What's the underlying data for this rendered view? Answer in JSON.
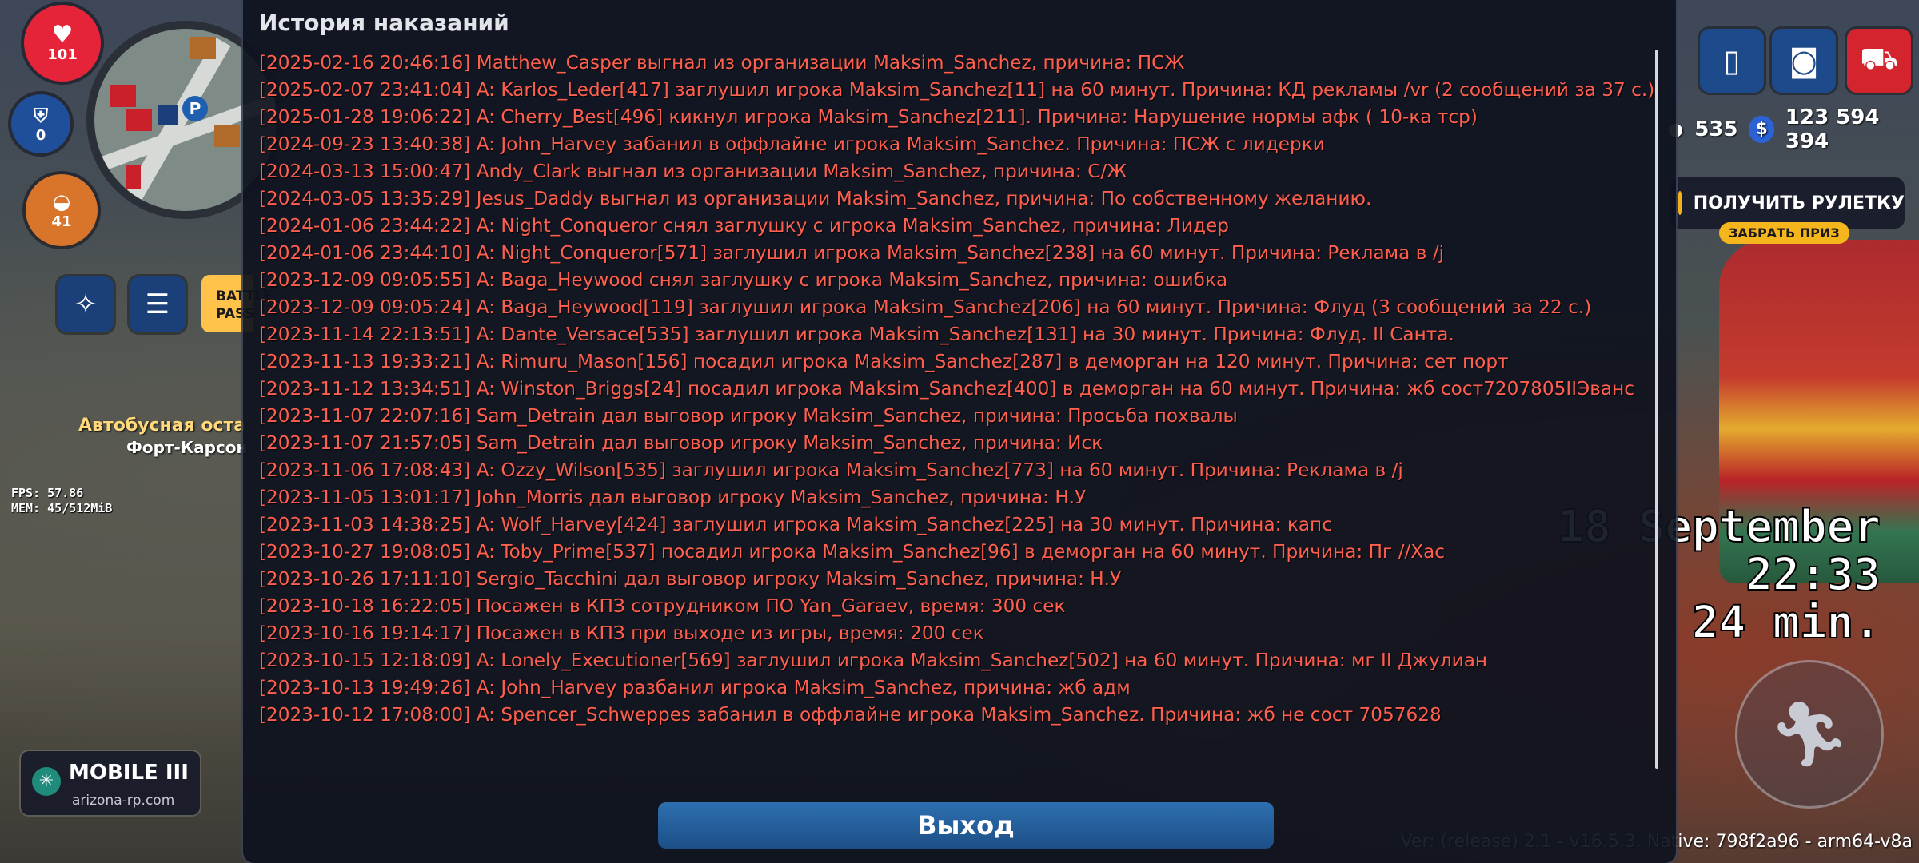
{
  "hud": {
    "health": "101",
    "armor": "0",
    "hunger": "41",
    "battle_pass": "BATTLE PASS",
    "bus_stop": "Автобусная оста",
    "location": "Форт-Карсон",
    "fps": "FPS:  57.86",
    "mem": "MEM: 45/512MiB",
    "logo_title": "MOBILE III",
    "logo_site": "arizona-rp.com",
    "donate_count": "535",
    "money": "123 594 394",
    "roulette": "ПОЛУЧИТЬ РУЛЕТКУ",
    "prize": "ЗАБРАТЬ ПРИЗ",
    "date_line": "18 September",
    "time_line": "22:33",
    "played_line": "24 min.",
    "version": "Ver: (release) 2.1 - v16.5.3. Native: 798f2a96 - arm64-v8a"
  },
  "panel": {
    "title": "История наказаний",
    "lines": [
      "[2025-02-16 20:46:16] Matthew_Casper выгнал из организации Maksim_Sanchez, причина: ПСЖ",
      "[2025-02-07 23:41:04]  A: Karlos_Leder[417] заглушил игрока Maksim_Sanchez[11] на 60 минут. Причина: КД рекламы /vr (2 сообщений за 37 с.)",
      "[2025-01-28 19:06:22]  A: Cherry_Best[496] кикнул игрока Maksim_Sanchez[211]. Причина: Нарушение нормы афк ( 10-ка тср)",
      "[2024-09-23 13:40:38]  A: John_Harvey забанил в оффлайне игрока Maksim_Sanchez. Причина: ПСЖ с лидерки",
      "[2024-03-13 15:00:47] Andy_Clark выгнал из организации Maksim_Sanchez, причина: С/Ж",
      "[2024-03-05 13:35:29] Jesus_Daddy выгнал из организации Maksim_Sanchez, причина: По собственному желанию.",
      "[2024-01-06 23:44:22]  A:  Night_Conqueror снял заглушку с игрока Maksim_Sanchez, причина: Лидер",
      "[2024-01-06 23:44:10]  A: Night_Conqueror[571] заглушил игрока Maksim_Sanchez[238] на 60 минут. Причина: Реклама в /j",
      "[2023-12-09 09:05:55]  A:  Baga_Heywood снял заглушку с игрока Maksim_Sanchez, причина: ошибка",
      "[2023-12-09 09:05:24]  A: Baga_Heywood[119] заглушил игрока Maksim_Sanchez[206] на 60 минут. Причина: Флуд (3 сообщений за 22 с.)",
      "[2023-11-14 22:13:51]  A: Dante_Versace[535] заглушил игрока Maksim_Sanchez[131] на 30 минут. Причина: Флуд. II Санта.",
      "[2023-11-13 19:33:21]  A: Rimuru_Mason[156] посадил игрока Maksim_Sanchez[287] в деморган на 120 минут. Причина: сет порт",
      "[2023-11-12 13:34:51]  A: Winston_Briggs[24] посадил игрока Maksim_Sanchez[400] в деморган на 60 минут. Причина: жб сост7207805IIЭванс",
      "[2023-11-07 22:07:16] Sam_Detrain дал выговор игроку Maksim_Sanchez, причина: Просьба похвалы",
      "[2023-11-07 21:57:05] Sam_Detrain дал выговор игроку Maksim_Sanchez, причина: Иск",
      "[2023-11-06 17:08:43]  A: Ozzy_Wilson[535] заглушил игрока Maksim_Sanchez[773] на 60 минут. Причина: Реклама в /j",
      "[2023-11-05 13:01:17] John_Morris дал выговор игроку Maksim_Sanchez, причина: Н.У",
      "[2023-11-03 14:38:25]  A: Wolf_Harvey[424] заглушил игрока Maksim_Sanchez[225] на 30 минут. Причина: капс",
      "[2023-10-27 19:08:05]  A: Toby_Prime[537] посадил игрока Maksim_Sanchez[96] в деморган на 60 минут. Причина: Пг //Хас",
      "[2023-10-26 17:11:10] Sergio_Tacchini дал выговор игроку Maksim_Sanchez, причина: Н.У",
      "[2023-10-18 16:22:05] Посажен в КПЗ сотрудником ПО Yan_Garaev, время: 300 сек",
      "[2023-10-16 19:14:17] Посажен в КПЗ при выходе из игры, время: 200 сек",
      "[2023-10-15 12:18:09]  A: Lonely_Executioner[569] заглушил игрока Maksim_Sanchez[502] на 60 минут. Причина: мг II Джулиан",
      "[2023-10-13 19:49:26]  A: John_Harvey разбанил игрока Maksim_Sanchez, причина: жб адм",
      "[2023-10-12 17:08:00]  A: Spencer_Schweppes забанил в оффлайне игрока Maksim_Sanchez. Причина: жб не сост 7057628"
    ],
    "exit_label": "Выход"
  }
}
